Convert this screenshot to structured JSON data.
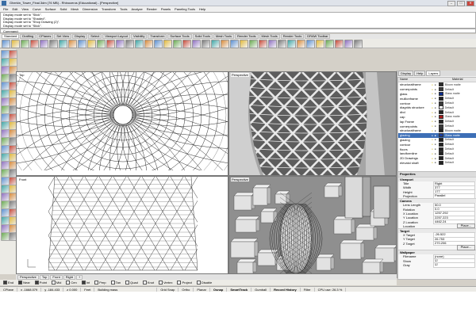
{
  "titlebar": {
    "title": "Gherkin_Tower_Final.3dm (76 MB) - Rhinoceros (Educational) - [Perspective]",
    "min": "–",
    "max": "□",
    "close": "✕"
  },
  "menu": [
    "File",
    "Edit",
    "View",
    "Curve",
    "Surface",
    "Solid",
    "Mesh",
    "Dimension",
    "Transform",
    "Tools",
    "Analyze",
    "Render",
    "Panels",
    "Paneling Tools",
    "Help"
  ],
  "command_history": [
    "Display mode set to \"Slick\".",
    "Display mode set to \"Shaded\".",
    "Display mode set to \"Shop Drawing (2)\".",
    "Display mode set to \"Slick\"."
  ],
  "command_prompt": "Command:",
  "toolbar_tabs": [
    "Standard",
    "Drafting",
    "CPlanes",
    "Set View",
    "Display",
    "Select",
    "Viewport Layout",
    "Visibility",
    "Transform",
    "Surface Tools",
    "Solid Tools",
    "Mesh Tools",
    "Render Tools",
    "Mesh Tools",
    "Render Tools",
    "DRAW Toolbar"
  ],
  "viewports": {
    "top_left": "Top",
    "top_right": "Perspective",
    "bottom_left": "Front",
    "bottom_right": "Perspective"
  },
  "viewport_tabs": [
    "Perspective",
    "Top",
    "Front",
    "Right",
    "+"
  ],
  "osnaps": [
    {
      "label": "End",
      "on": true
    },
    {
      "label": "Near",
      "on": true
    },
    {
      "label": "Point",
      "on": true
    },
    {
      "label": "Mid",
      "on": false
    },
    {
      "label": "Cen",
      "on": false
    },
    {
      "label": "Int",
      "on": true
    },
    {
      "label": "Perp",
      "on": false
    },
    {
      "label": "Tan",
      "on": false
    },
    {
      "label": "Quad",
      "on": false
    },
    {
      "label": "Knot",
      "on": false
    },
    {
      "label": "Vertex",
      "on": false
    },
    {
      "label": "Project",
      "on": false
    },
    {
      "label": "Disable",
      "on": false
    }
  ],
  "status": {
    "cplane": "CPlane",
    "x": "x -1668.079",
    "y": "y -184.433",
    "z": "z 0.000",
    "units": "Feet",
    "layer": "Building mass",
    "grid_snap": "Grid Snap",
    "ortho": "Ortho",
    "planar": "Planar",
    "osnap": "Osnap",
    "smarttrack": "SmartTrack",
    "gumball": "Gumball",
    "record_history": "Record History",
    "filter": "Filter",
    "cpu": "CPU use: 26.3 %"
  },
  "panel": {
    "tabs": [
      "Display",
      "Help",
      "Layers"
    ],
    "layers_header": [
      "Name",
      "",
      "Material"
    ],
    "layers": [
      {
        "name": "structuralframe",
        "color": "#2b2b2b",
        "mat": "Bloom matte",
        "sel": false
      },
      {
        "name": "cornerpoints",
        "color": "#3a3a3a",
        "mat": "Default",
        "sel": false
      },
      {
        "name": "glass",
        "color": "#0a2b8a",
        "mat": "Glass matte",
        "sel": false
      },
      {
        "name": "mullionframe",
        "color": "#222222",
        "mat": "Default",
        "sel": false
      },
      {
        "name": "contour",
        "color": "#3a3a3a",
        "mat": "Default",
        "sel": false
      },
      {
        "name": "diagrids structure",
        "color": "#ffffff",
        "mat": "Default",
        "sel": false
      },
      {
        "name": "dbd",
        "color": "#222222",
        "mat": "Default",
        "sel": false
      },
      {
        "name": "cap",
        "color": "#a61a1a",
        "mat": "Glass matte",
        "sel": false
      },
      {
        "name": "lap Frame",
        "color": "#222222",
        "mat": "Default",
        "sel": false
      },
      {
        "name": "cornerpoints",
        "color": "#3a3a3a",
        "mat": "Default",
        "sel": false
      },
      {
        "name": "structuralframe",
        "color": "#222222",
        "mat": "Bloom matte",
        "sel": false
      },
      {
        "name": "glazing",
        "color": "#1a3c9a",
        "mat": "Glass matte",
        "sel": true
      },
      {
        "name": "glazing",
        "color": "#222222",
        "mat": "Default",
        "sel": false
      },
      {
        "name": "contour",
        "color": "#222222",
        "mat": "Default",
        "sel": false
      },
      {
        "name": "floors",
        "color": "#222222",
        "mat": "Default",
        "sel": false
      },
      {
        "name": "landformline",
        "color": "#222222",
        "mat": "Default",
        "sel": false
      },
      {
        "name": "2D Drawings",
        "color": "#222222",
        "mat": "Default",
        "sel": false
      },
      {
        "name": "elevatoi shaft",
        "color": "#222222",
        "mat": "Default",
        "sel": false
      }
    ],
    "properties": {
      "header": "Properties",
      "viewport_section": "Viewport",
      "viewport_rows": [
        {
          "k": "Title",
          "v": "Right"
        },
        {
          "k": "Width",
          "v": "377"
        },
        {
          "k": "Height",
          "v": "177"
        },
        {
          "k": "Projection",
          "v": "Parallel"
        }
      ],
      "camera_section": "Camera",
      "camera_rows": [
        {
          "k": "Lens Length",
          "v": "50.0"
        },
        {
          "k": "Rotation",
          "v": "0.0"
        },
        {
          "k": "X Location",
          "v": "1257.292"
        },
        {
          "k": "Y Location",
          "v": "2257.223"
        },
        {
          "k": "Z Location",
          "v": "4462.24"
        }
      ],
      "location_label": "Location",
      "place_label": "Place...",
      "target_section": "Target",
      "target_rows": [
        {
          "k": "X Target",
          "v": "-26.522"
        },
        {
          "k": "Y Target",
          "v": "26.753"
        },
        {
          "k": "Z Target",
          "v": "270.206"
        }
      ],
      "wallpaper_section": "Wallpaper",
      "wallpaper_rows": [
        {
          "k": "Filename",
          "v": "(none)"
        },
        {
          "k": "Show",
          "v": "☑"
        },
        {
          "k": "Gray",
          "v": "☑"
        }
      ]
    }
  }
}
